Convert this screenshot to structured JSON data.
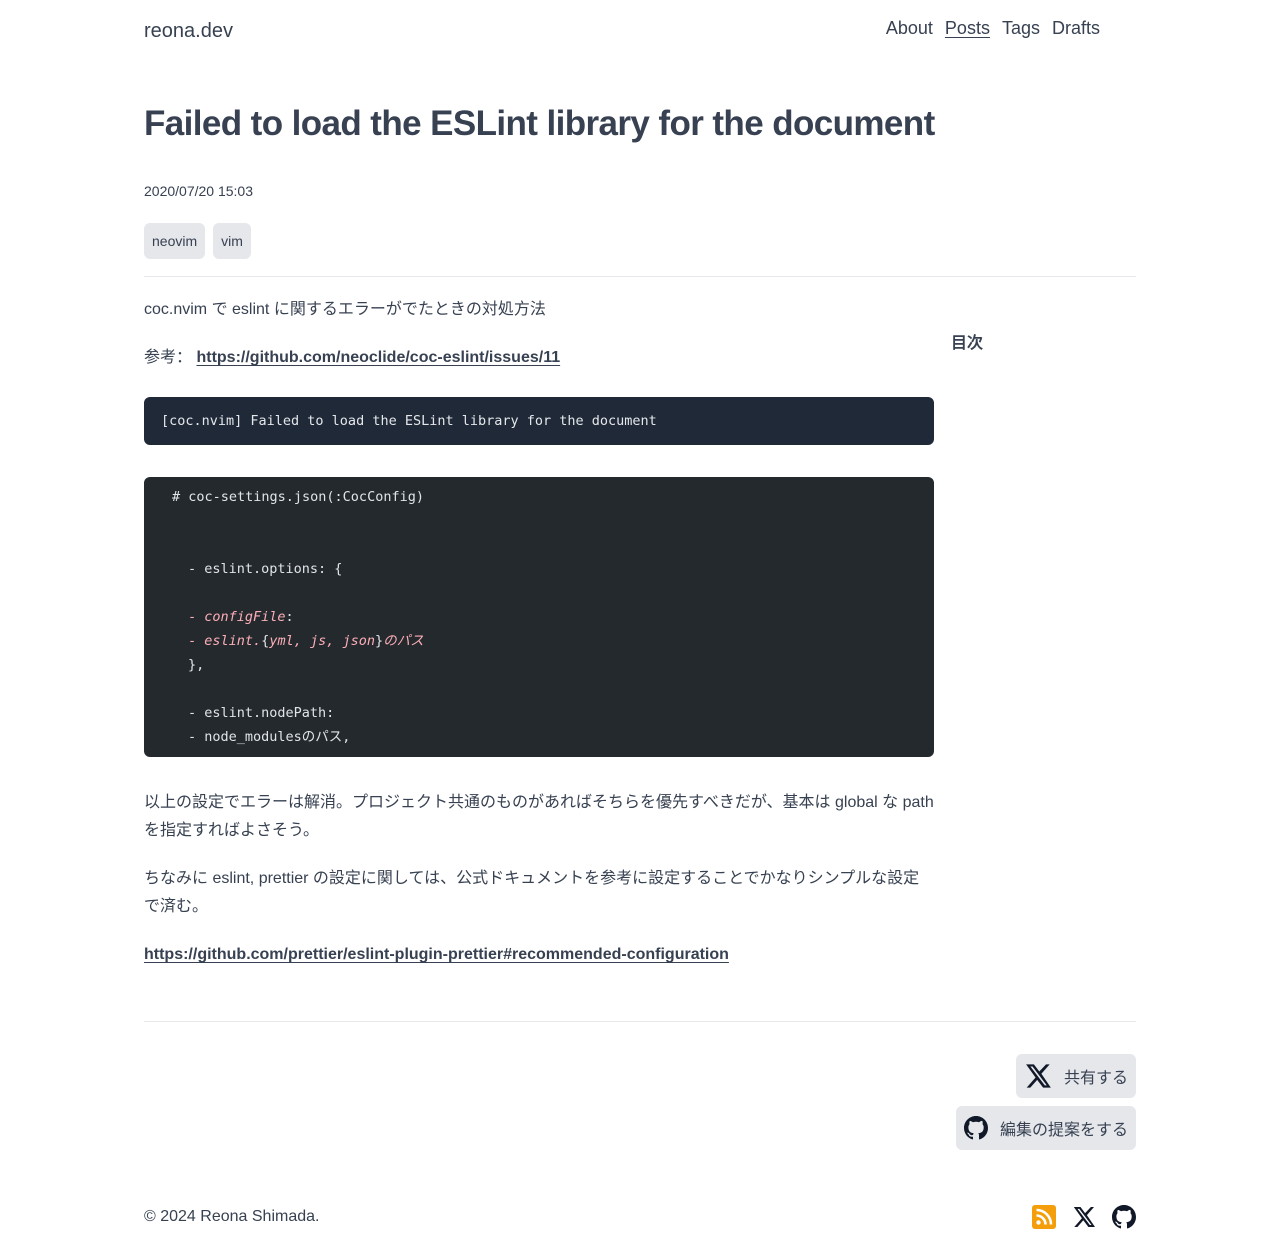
{
  "header": {
    "brand": "reona.dev",
    "nav": [
      {
        "label": "About"
      },
      {
        "label": "Posts",
        "active": true
      },
      {
        "label": "Tags"
      },
      {
        "label": "Drafts"
      }
    ]
  },
  "post": {
    "title": "Failed to load the ESLint library for the document",
    "date": "2020/07/20 15:03",
    "tags": [
      "neovim",
      "vim"
    ],
    "intro": "coc.nvim で eslint に関するエラーがでたときの対処方法",
    "ref_prefix": "参考：",
    "ref_link": "https://github.com/neoclide/coc-eslint/issues/11",
    "error_code": "[coc.nvim] Failed to load the ESLint library for the document",
    "config_code": {
      "comment": "# coc-settings.json(:CocConfig)",
      "line_options": "- eslint.options: {",
      "line_configfile_key": "configFile",
      "line_eslint_prefix": "eslint.",
      "line_eslint_exts": "yml, js, json",
      "line_eslint_suffix": "のパス",
      "line_close": "},",
      "line_nodepath": "- eslint.nodePath:",
      "line_nodemodules": "- node_modulesのパス,"
    },
    "after1": "以上の設定でエラーは解消。プロジェクト共通のものがあればそちらを優先すべきだが、基本は global な path を指定すればよさそう。",
    "after2": "ちなみに eslint, prettier の設定に関しては、公式ドキュメントを参考に設定することでかなりシンプルな設定で済む。",
    "link2": "https://github.com/prettier/eslint-plugin-prettier#recommended-configuration"
  },
  "toc": {
    "label": "目次"
  },
  "actions": {
    "share_label": "共有する",
    "edit_label": "編集の提案をする"
  },
  "footer": {
    "copyright": "© 2024 Reona Shimada.",
    "icons": [
      "rss-icon",
      "x-icon",
      "github-icon"
    ],
    "rss_color": "#f59e0b"
  }
}
